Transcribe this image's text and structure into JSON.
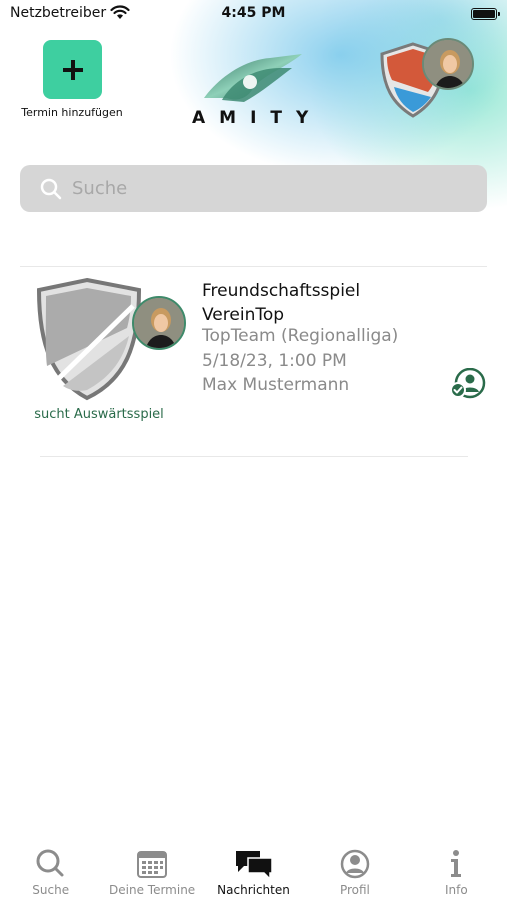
{
  "status_bar": {
    "carrier": "Netzbetreiber",
    "time": "4:45 PM"
  },
  "header": {
    "add_button_label": "Termin hinzufügen",
    "logo_text": "AMITY"
  },
  "search": {
    "placeholder": "Suche"
  },
  "matches": [
    {
      "title_line1": "Freundschaftsspiel",
      "title_line2": "VereinTop",
      "team": "TopTeam (Regionalliga)",
      "date": "5/18/23, 1:00 PM",
      "user": "Max Mustermann",
      "status": "sucht Auswärtsspiel"
    }
  ],
  "tabs": [
    {
      "label": "Suche",
      "icon": "search-icon",
      "active": false
    },
    {
      "label": "Deine Termine",
      "icon": "calendar-icon",
      "active": false
    },
    {
      "label": "Nachrichten",
      "icon": "chat-bubbles-icon",
      "active": true
    },
    {
      "label": "Profil",
      "icon": "profile-icon",
      "active": false
    },
    {
      "label": "Info",
      "icon": "info-icon",
      "active": false
    }
  ],
  "colors": {
    "accent": "#3ecfa0",
    "status_green": "#2a6b4a",
    "muted_text": "#8a8a8a"
  }
}
